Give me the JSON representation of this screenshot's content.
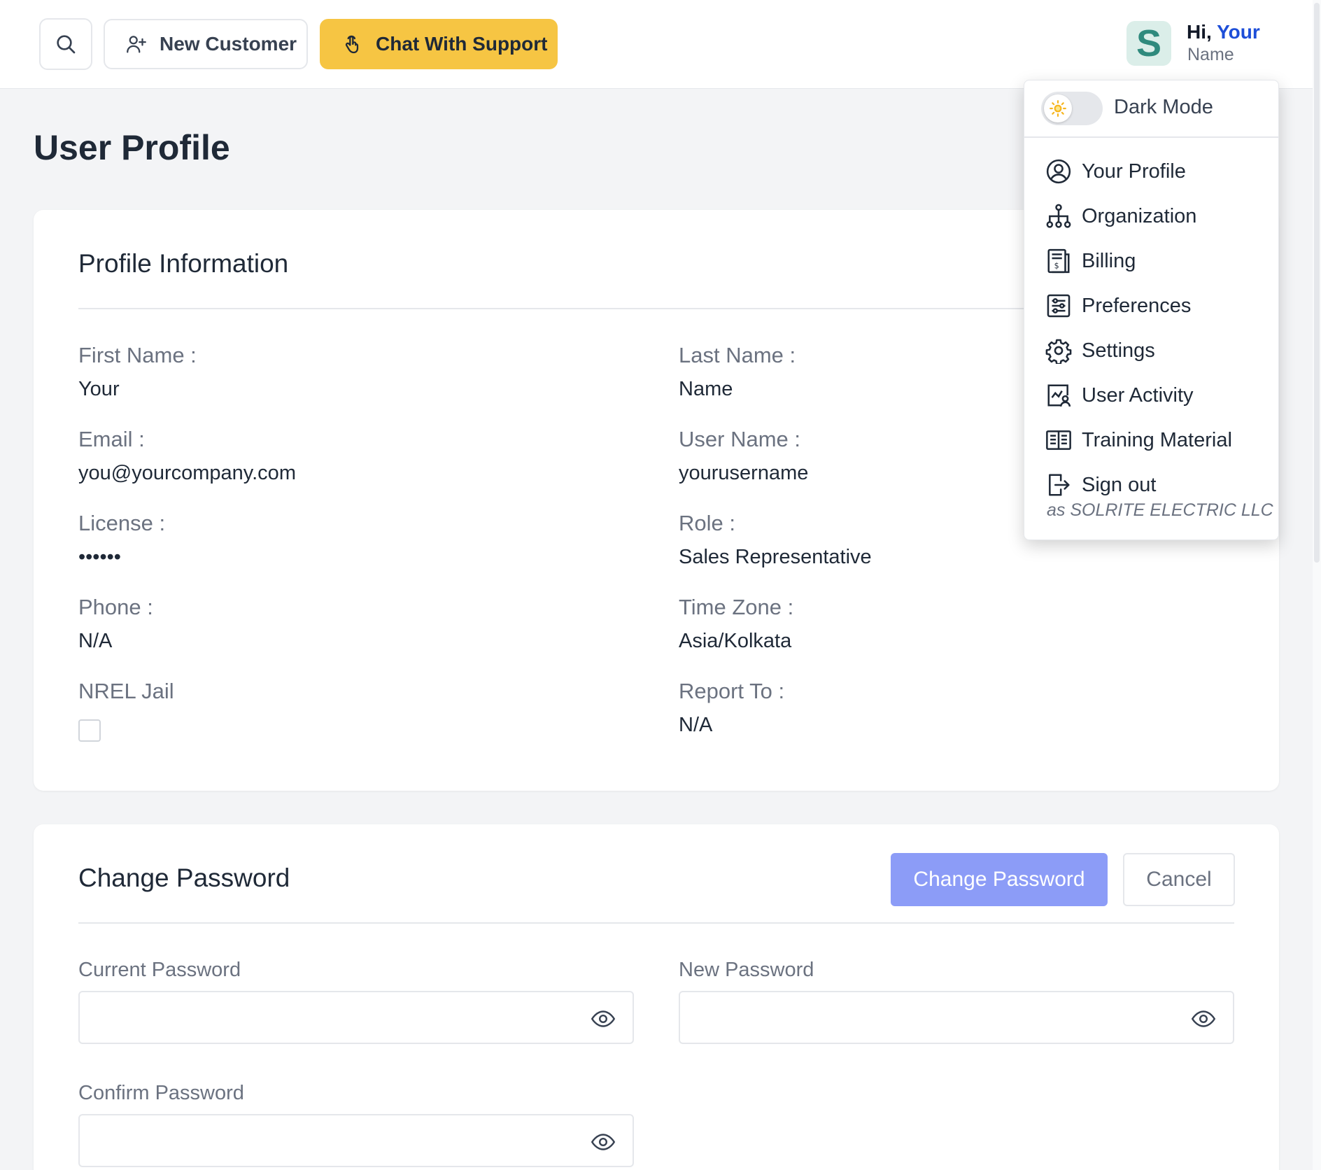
{
  "topbar": {
    "new_customer_label": "New Customer",
    "chat_support_label": "Chat With Support",
    "avatar_letter": "S",
    "greeting_prefix": "Hi,",
    "greeting_name": "Your",
    "greeting_sub": "Name"
  },
  "page": {
    "title": "User Profile"
  },
  "profile": {
    "title": "Profile Information",
    "fields": [
      {
        "label": "First Name :",
        "value": "Your"
      },
      {
        "label": "Last Name :",
        "value": "Name"
      },
      {
        "label": "Email :",
        "value": "you@yourcompany.com"
      },
      {
        "label": "User Name :",
        "value": "yourusername"
      },
      {
        "label": "License :",
        "value": "••••••"
      },
      {
        "label": "Role :",
        "value": "Sales Representative"
      },
      {
        "label": "Phone :",
        "value": "N/A"
      },
      {
        "label": "Time Zone :",
        "value": "Asia/Kolkata"
      },
      {
        "label": "NREL Jail",
        "value": ""
      },
      {
        "label": "Report To :",
        "value": "N/A"
      }
    ]
  },
  "password": {
    "title": "Change Password",
    "submit_label": "Change Password",
    "cancel_label": "Cancel",
    "current_label": "Current Password",
    "new_label": "New Password",
    "confirm_label": "Confirm Password"
  },
  "menu": {
    "dark_mode_label": "Dark Mode",
    "items": [
      {
        "label": "Your Profile",
        "icon": "user-circle-icon"
      },
      {
        "label": "Organization",
        "icon": "org-chart-icon"
      },
      {
        "label": "Billing",
        "icon": "invoice-icon"
      },
      {
        "label": "Preferences",
        "icon": "sliders-icon"
      },
      {
        "label": "Settings",
        "icon": "gear-icon"
      },
      {
        "label": "User Activity",
        "icon": "activity-icon"
      },
      {
        "label": "Training Material",
        "icon": "book-icon"
      },
      {
        "label": "Sign out",
        "icon": "sign-out-icon"
      }
    ],
    "signout_sub": "as SOLRITE ELECTRIC LLC"
  },
  "colors": {
    "accent_yellow": "#f6c543",
    "primary_button": "#8c9cf7",
    "greeting_blue": "#1d4ed8",
    "avatar_teal": "#2f8a7d"
  }
}
